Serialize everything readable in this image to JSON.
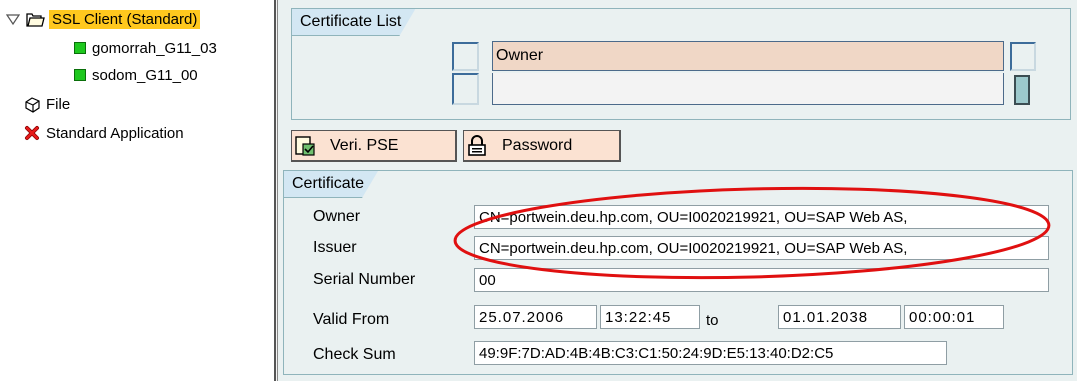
{
  "tree": {
    "root_label": "SSL Client (Standard)",
    "children": [
      "gomorrah_G11_03",
      "sodom_G11_00"
    ],
    "file_label": "File",
    "std_app_label": "Standard Application"
  },
  "certificate_list": {
    "title": "Certificate List",
    "column_header": "Owner"
  },
  "buttons": {
    "veri_pse": "Veri. PSE",
    "password": "Password"
  },
  "certificate": {
    "title": "Certificate",
    "owner_label": "Owner",
    "owner_value": "CN=portwein.deu.hp.com, OU=I0020219921, OU=SAP Web AS, ",
    "issuer_label": "Issuer",
    "issuer_value": "CN=portwein.deu.hp.com, OU=I0020219921, OU=SAP Web AS, ",
    "serial_label": "Serial Number",
    "serial_value": "00",
    "valid_label": "Valid From",
    "valid_from_date": "25.07.2006",
    "valid_from_time": "13:22:45",
    "to_label": "to",
    "valid_to_date": "01.01.2038",
    "valid_to_time": "00:00:01",
    "checksum_label": "Check Sum",
    "checksum_value": "49:9F:7D:AD:4B:4B:C3:C1:50:24:9D:E5:13:40:D2:C5"
  },
  "icons": {
    "expander": "triangle-down-icon",
    "folder": "folder-icon",
    "status": "green-square-icon",
    "file": "box-icon",
    "application": "red-x-icon",
    "veri": "verify-icon",
    "password": "lock-icon"
  },
  "colors": {
    "selection": "#ffc81e",
    "panel_bg": "#eaf1f1",
    "tab_bg": "#d3e7f3",
    "button_bg": "#fbe2d2",
    "header_bg": "#f0d7c6",
    "highlight_ellipse": "#e01010"
  }
}
